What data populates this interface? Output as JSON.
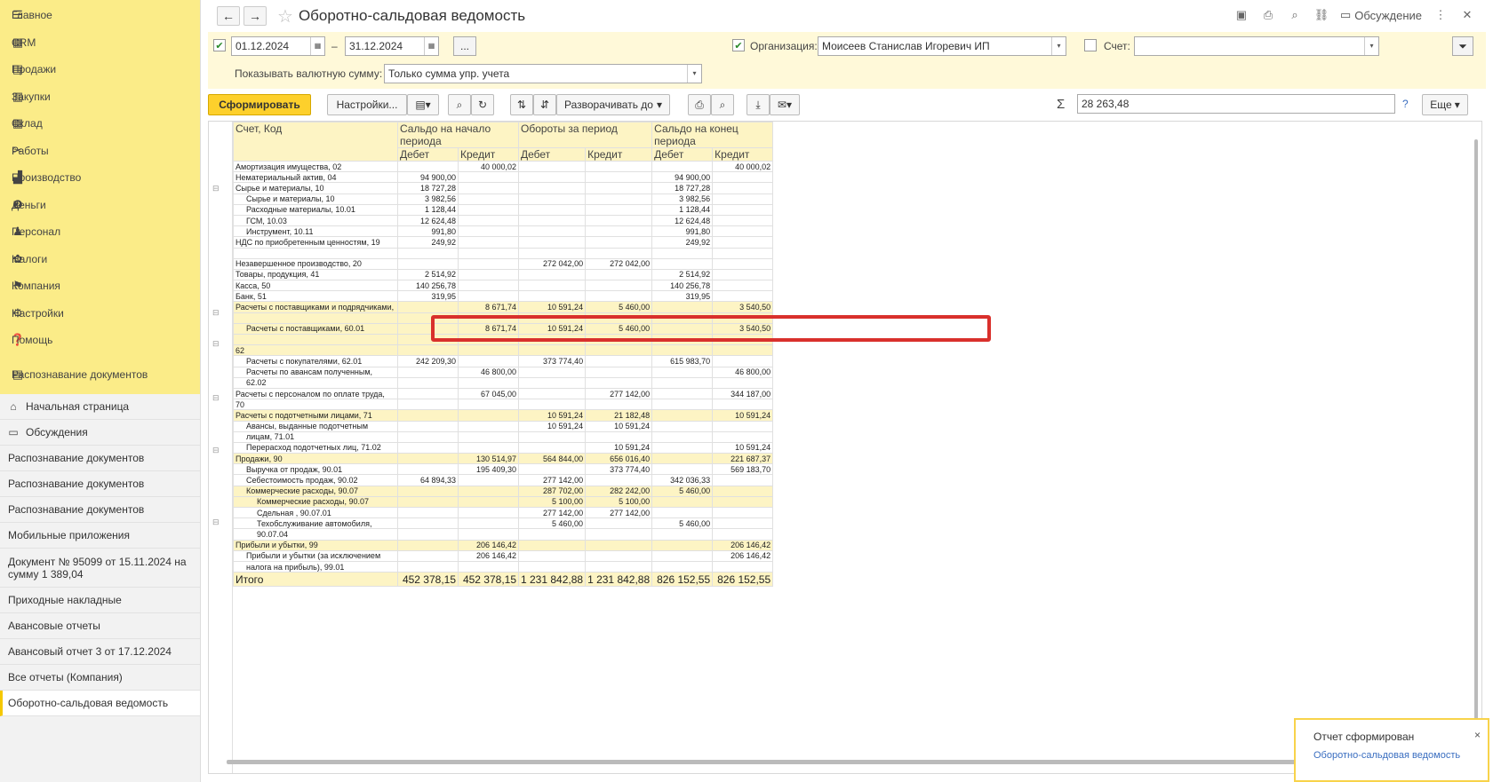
{
  "sidebar": {
    "sections": [
      {
        "label": "Главное",
        "icon": "menu-icon"
      },
      {
        "label": "CRM",
        "icon": "crm-icon"
      },
      {
        "label": "Продажи",
        "icon": "sales-icon"
      },
      {
        "label": "Закупки",
        "icon": "purchases-icon"
      },
      {
        "label": "Склад",
        "icon": "warehouse-icon"
      },
      {
        "label": "Работы",
        "icon": "works-icon"
      },
      {
        "label": "Производство",
        "icon": "production-icon"
      },
      {
        "label": "Деньги",
        "icon": "money-icon"
      },
      {
        "label": "Персонал",
        "icon": "personnel-icon"
      },
      {
        "label": "Налоги",
        "icon": "taxes-icon"
      },
      {
        "label": "Компания",
        "icon": "company-icon"
      },
      {
        "label": "Настройки",
        "icon": "settings-icon"
      },
      {
        "label": "Помощь",
        "icon": "help-icon"
      },
      {
        "label": "Распознавание документов",
        "icon": "recognition-icon"
      }
    ],
    "open": [
      {
        "label": "Начальная страница",
        "icon": "home-icon"
      },
      {
        "label": "Обсуждения",
        "icon": "discussions-icon"
      },
      {
        "label": "Распознавание документов"
      },
      {
        "label": "Распознавание документов"
      },
      {
        "label": "Распознавание документов"
      },
      {
        "label": "Мобильные приложения"
      },
      {
        "label": "Документ № 95099 от 15.11.2024 на сумму 1 389,04"
      },
      {
        "label": "Приходные накладные"
      },
      {
        "label": "Авансовые отчеты"
      },
      {
        "label": "Авансовый отчет 3 от 17.12.2024"
      },
      {
        "label": "Все отчеты (Компания)"
      },
      {
        "label": "Оборотно-сальдовая ведомость"
      }
    ]
  },
  "header": {
    "title": "Оборотно-сальдовая ведомость",
    "discussion": "Обсуждение"
  },
  "params": {
    "date_from": "01.12.2024",
    "date_to": "31.12.2024",
    "dash": "–",
    "more": "...",
    "org_label": "Организация:",
    "org_value": "Моисеев Станислав Игоревич ИП",
    "account_label": "Счет:",
    "account_value": "",
    "currency_label": "Показывать валютную сумму:",
    "currency_value": "Только сумма упр. учета"
  },
  "toolbar": {
    "generate": "Сформировать",
    "settings": "Настройки...",
    "expand": "Разворачивать до",
    "sum": "28 263,48",
    "more": "Еще",
    "help": "?"
  },
  "table": {
    "h_account": "Счет, Код",
    "h_open": "Сальдо на начало периода",
    "h_turn": "Обороты за период",
    "h_close": "Сальдо на конец периода",
    "h_debit": "Дебет",
    "h_credit": "Кредит",
    "rows": [
      {
        "name": "Амортизация имущества, 02",
        "v": [
          "",
          "40 000,02",
          "",
          "",
          "",
          "40 000,02"
        ],
        "lvl": 0
      },
      {
        "name": "Нематериальный актив, 04",
        "v": [
          "94 900,00",
          "",
          "",
          "",
          "94 900,00",
          ""
        ],
        "lvl": 0
      },
      {
        "name": "Сырье и материалы, 10",
        "v": [
          "18 727,28",
          "",
          "",
          "",
          "18 727,28",
          ""
        ],
        "lvl": 0
      },
      {
        "name": "Сырье и материалы, 10",
        "v": [
          "3 982,56",
          "",
          "",
          "",
          "3 982,56",
          ""
        ],
        "lvl": 1
      },
      {
        "name": "Расходные материалы, 10.01",
        "v": [
          "1 128,44",
          "",
          "",
          "",
          "1 128,44",
          ""
        ],
        "lvl": 1
      },
      {
        "name": "ГСМ, 10.03",
        "v": [
          "12 624,48",
          "",
          "",
          "",
          "12 624,48",
          ""
        ],
        "lvl": 1
      },
      {
        "name": "Инструмент, 10.11",
        "v": [
          "991,80",
          "",
          "",
          "",
          "991,80",
          ""
        ],
        "lvl": 1
      },
      {
        "name": "НДС по приобретенным ценностям, 19",
        "v": [
          "249,92",
          "",
          "",
          "",
          "249,92",
          ""
        ],
        "lvl": 0
      },
      {
        "name": "",
        "v": [
          "",
          "",
          "",
          "",
          "",
          ""
        ],
        "lvl": 0
      },
      {
        "name": "Незавершенное производство, 20",
        "v": [
          "",
          "",
          "272 042,00",
          "272 042,00",
          "",
          ""
        ],
        "lvl": 0
      },
      {
        "name": "Товары, продукция, 41",
        "v": [
          "2 514,92",
          "",
          "",
          "",
          "2 514,92",
          ""
        ],
        "lvl": 0
      },
      {
        "name": "Касса, 50",
        "v": [
          "140 256,78",
          "",
          "",
          "",
          "140 256,78",
          ""
        ],
        "lvl": 0
      },
      {
        "name": "Банк, 51",
        "v": [
          "319,95",
          "",
          "",
          "",
          "319,95",
          ""
        ],
        "lvl": 0
      },
      {
        "name": "Расчеты с поставщиками и подрядчиками,",
        "v": [
          "",
          "8 671,74",
          "10 591,24",
          "5 460,00",
          "",
          "3 540,50"
        ],
        "lvl": 0,
        "grp": true
      },
      {
        "name": "",
        "v": [
          "",
          "",
          "",
          "",
          "",
          ""
        ],
        "lvl": 0,
        "grp": true
      },
      {
        "name": "Расчеты с поставщиками, 60.01",
        "v": [
          "",
          "8 671,74",
          "10 591,24",
          "5 460,00",
          "",
          "3 540,50"
        ],
        "lvl": 1,
        "grp": true
      },
      {
        "name": "",
        "v": [
          "",
          "",
          "",
          "",
          "",
          ""
        ],
        "lvl": 0,
        "grp": true
      },
      {
        "name": "62",
        "v": [
          "",
          "",
          "",
          "",
          "",
          ""
        ],
        "lvl": 0,
        "grp": true
      },
      {
        "name": "Расчеты с покупателями, 62.01",
        "v": [
          "242 209,30",
          "",
          "373 774,40",
          "",
          "615 983,70",
          ""
        ],
        "lvl": 1
      },
      {
        "name": "Расчеты по авансам полученным,",
        "v": [
          "",
          "46 800,00",
          "",
          "",
          "",
          "46 800,00"
        ],
        "lvl": 1
      },
      {
        "name": "62.02",
        "v": [
          "",
          "",
          "",
          "",
          "",
          ""
        ],
        "lvl": 1
      },
      {
        "name": "Расчеты с персоналом по оплате труда,",
        "v": [
          "",
          "67 045,00",
          "",
          "277 142,00",
          "",
          "344 187,00"
        ],
        "lvl": 0
      },
      {
        "name": "70",
        "v": [
          "",
          "",
          "",
          "",
          "",
          ""
        ],
        "lvl": 0
      },
      {
        "name": "Расчеты с подотчетными лицами, 71",
        "v": [
          "",
          "",
          "10 591,24",
          "21 182,48",
          "",
          "10 591,24"
        ],
        "lvl": 0,
        "grp": true
      },
      {
        "name": "Авансы, выданные подотчетным",
        "v": [
          "",
          "",
          "10 591,24",
          "10 591,24",
          "",
          ""
        ],
        "lvl": 1
      },
      {
        "name": "лицам, 71.01",
        "v": [
          "",
          "",
          "",
          "",
          "",
          ""
        ],
        "lvl": 1
      },
      {
        "name": "Перерасход подотчетных лиц, 71.02",
        "v": [
          "",
          "",
          "",
          "10 591,24",
          "",
          "10 591,24"
        ],
        "lvl": 1
      },
      {
        "name": "Продажи, 90",
        "v": [
          "",
          "130 514,97",
          "564 844,00",
          "656 016,40",
          "",
          "221 687,37"
        ],
        "lvl": 0,
        "grp": true
      },
      {
        "name": "Выручка от продаж, 90.01",
        "v": [
          "",
          "195 409,30",
          "",
          "373 774,40",
          "",
          "569 183,70"
        ],
        "lvl": 1
      },
      {
        "name": "Себестоимость продаж, 90.02",
        "v": [
          "64 894,33",
          "",
          "277 142,00",
          "",
          "342 036,33",
          ""
        ],
        "lvl": 1
      },
      {
        "name": "Коммерческие расходы, 90.07",
        "v": [
          "",
          "",
          "287 702,00",
          "282 242,00",
          "5 460,00",
          ""
        ],
        "lvl": 1,
        "grp": true
      },
      {
        "name": "Коммерческие расходы, 90.07",
        "v": [
          "",
          "",
          "5 100,00",
          "5 100,00",
          "",
          ""
        ],
        "lvl": 2,
        "grp": true
      },
      {
        "name": "Сдельная , 90.07.01",
        "v": [
          "",
          "",
          "277 142,00",
          "277 142,00",
          "",
          ""
        ],
        "lvl": 2
      },
      {
        "name": "Техобслуживание автомобиля,",
        "v": [
          "",
          "",
          "5 460,00",
          "",
          "5 460,00",
          ""
        ],
        "lvl": 2
      },
      {
        "name": "90.07.04",
        "v": [
          "",
          "",
          "",
          "",
          "",
          ""
        ],
        "lvl": 2
      },
      {
        "name": "Прибыли и убытки, 99",
        "v": [
          "",
          "206 146,42",
          "",
          "",
          "",
          "206 146,42"
        ],
        "lvl": 0,
        "grp": true
      },
      {
        "name": "Прибыли и убытки (за исключением",
        "v": [
          "",
          "206 146,42",
          "",
          "",
          "",
          "206 146,42"
        ],
        "lvl": 1
      },
      {
        "name": "налога на прибыль), 99.01",
        "v": [
          "",
          "",
          "",
          "",
          "",
          ""
        ],
        "lvl": 1
      }
    ],
    "total": {
      "name": "Итого",
      "v": [
        "452 378,15",
        "452 378,15",
        "1 231 842,88",
        "1 231 842,88",
        "826 152,55",
        "826 152,55"
      ]
    }
  },
  "notification": {
    "title": "Отчет сформирован",
    "link": "Оборотно-сальдовая ведомость",
    "close": "×"
  }
}
